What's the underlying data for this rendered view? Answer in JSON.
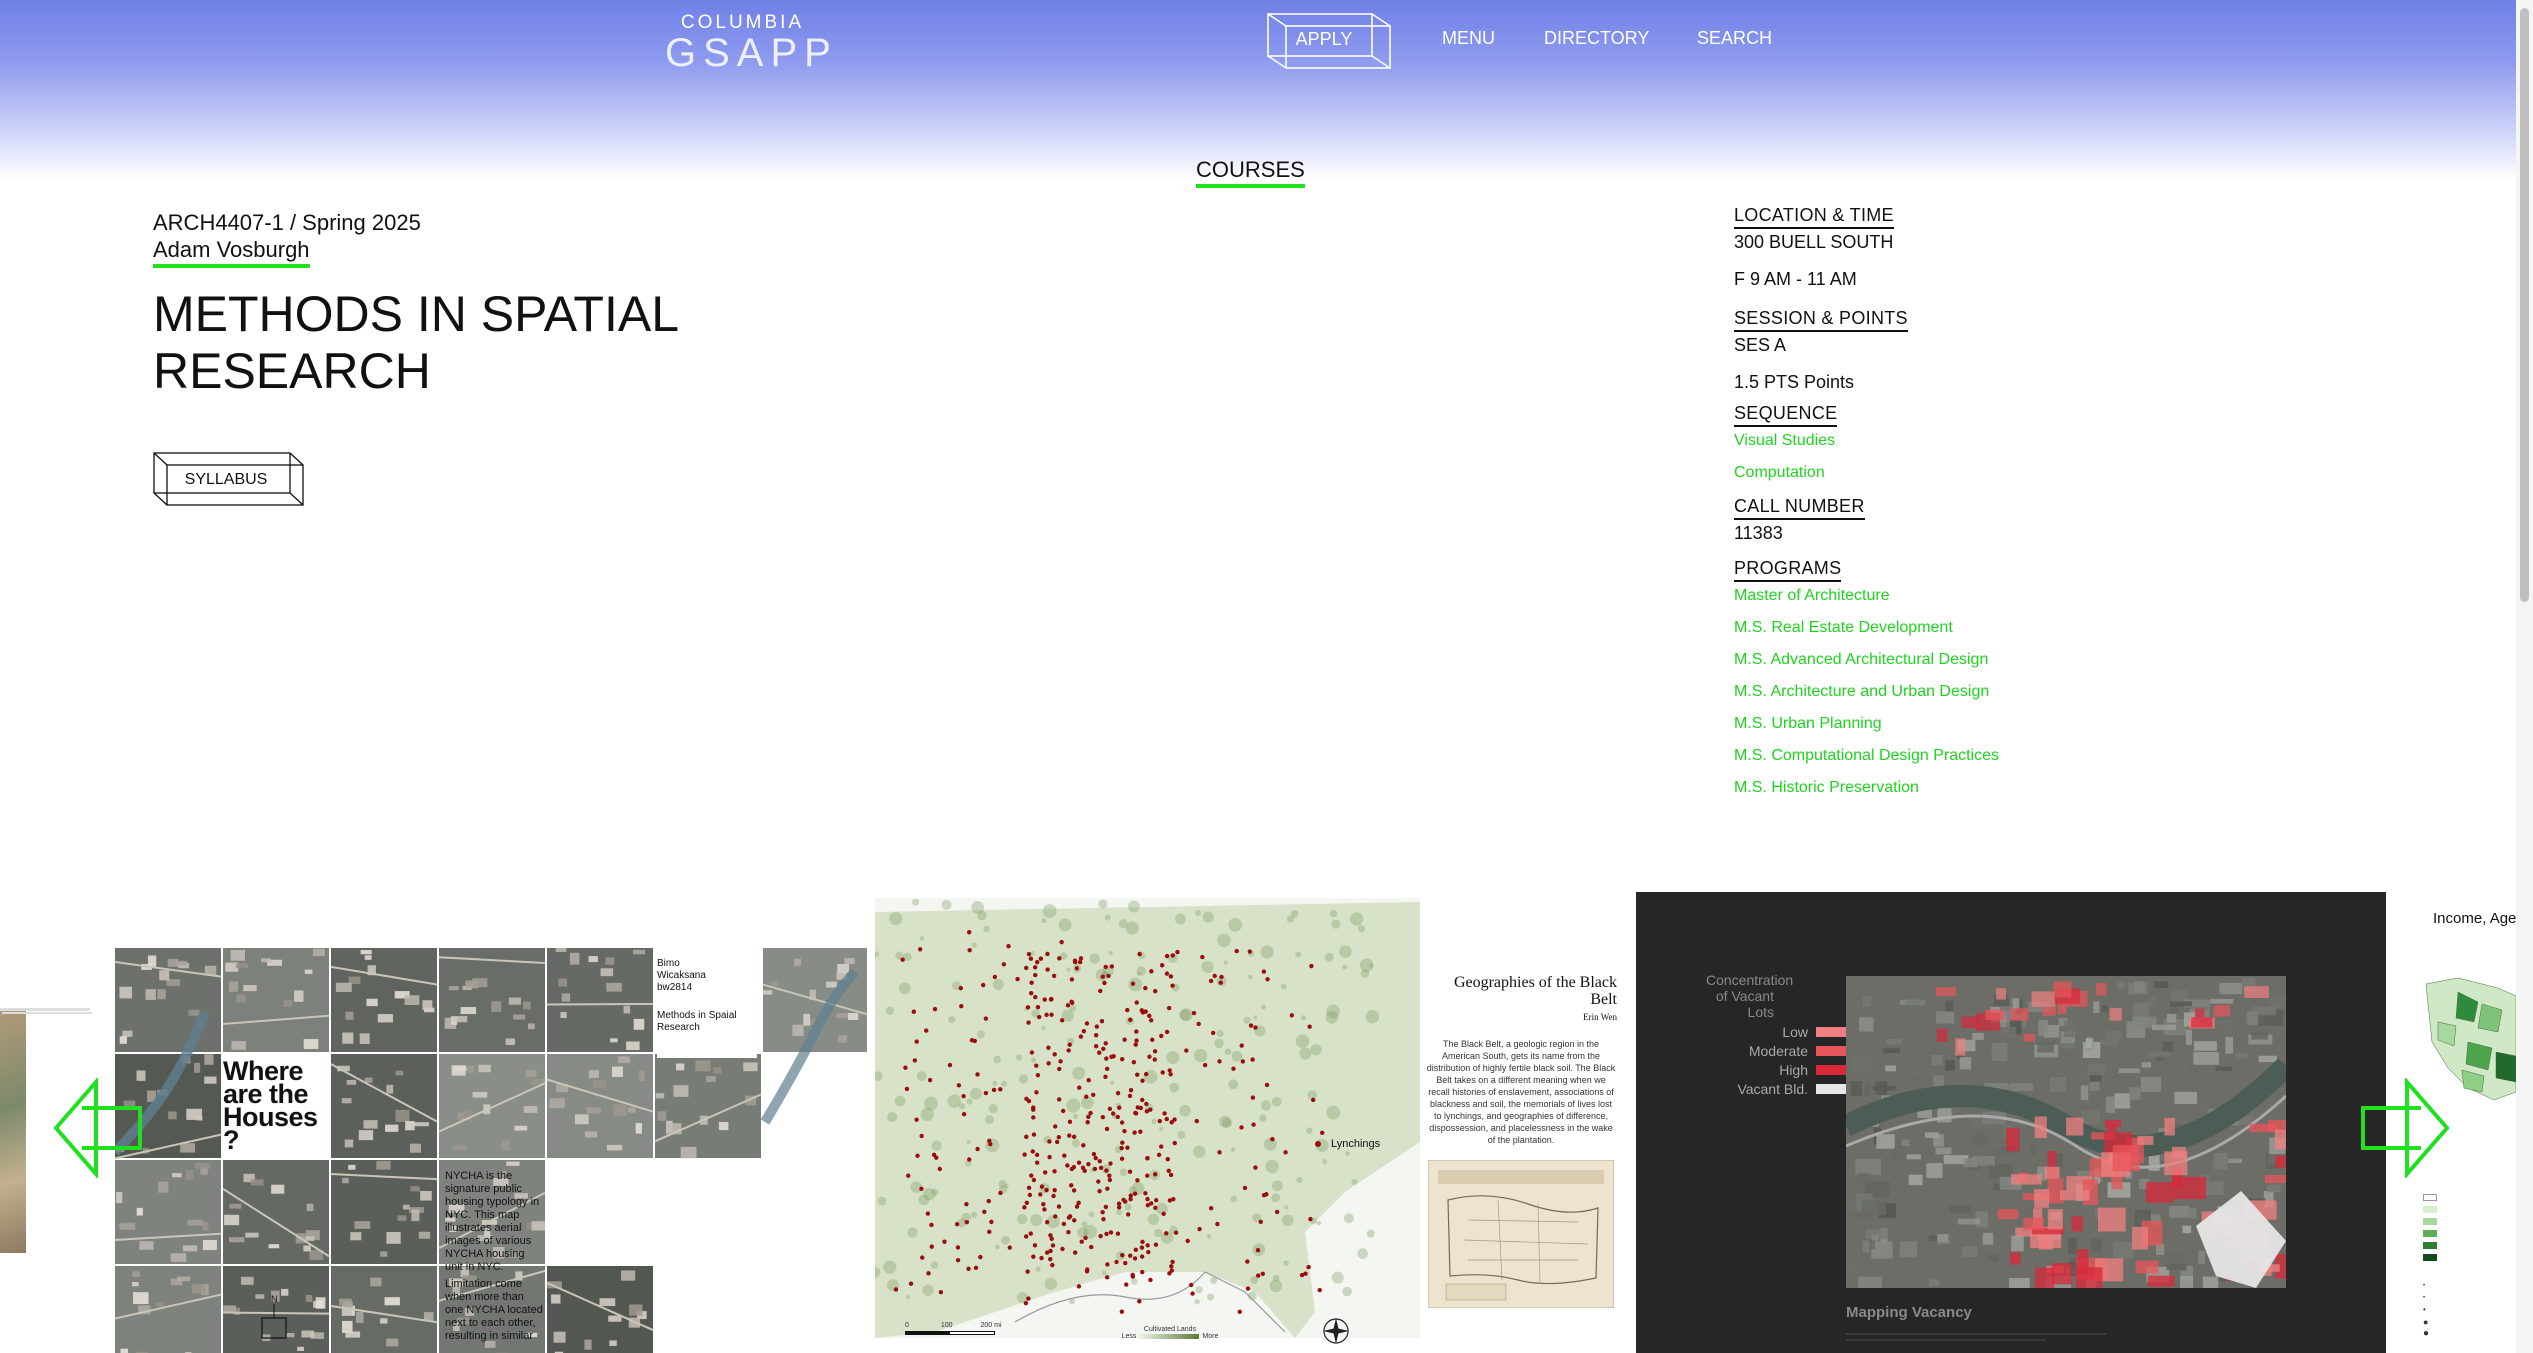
{
  "header": {
    "logo_top": "COLUMBIA",
    "logo_bottom": "GSAPP",
    "apply_label": "APPLY",
    "nav": [
      "MENU",
      "DIRECTORY",
      "SEARCH"
    ]
  },
  "breadcrumb": "COURSES",
  "course": {
    "code": "ARCH4407-1 / Spring 2025",
    "instructor": "Adam Vosburgh",
    "title": "METHODS IN SPATIAL RESEARCH",
    "syllabus_label": "SYLLABUS"
  },
  "sidebar": {
    "location_head": "LOCATION & TIME",
    "location": "300 BUELL SOUTH",
    "time": "F 9 AM - 11 AM",
    "session_head": "SESSION & POINTS",
    "session": "SES A",
    "points": "1.5 PTS Points",
    "sequence_head": "SEQUENCE",
    "sequence": [
      "Visual Studies",
      "Computation"
    ],
    "call_head": "CALL NUMBER",
    "call_number": "11383",
    "programs_head": "PROGRAMS",
    "programs": [
      "Master of Architecture",
      "M.S. Real Estate Development",
      "M.S. Advanced Architectural Design",
      "M.S. Architecture and Urban Design",
      "M.S. Urban Planning",
      "M.S. Computational Design Practices",
      "M.S. Historic Preservation"
    ]
  },
  "slides": {
    "houses": {
      "author": "Bimo Wicaksana bw2814",
      "course": "Methods in Spaial Research",
      "headline": "Where are the Houses ?",
      "body1": "NYCHA is the signature public housing typology in NYC. This map illustrates aerial images of various NYCHA housing unit in NYC.",
      "body2": "Limitation come when more than one NYCHA located next to each other, resulting in similar",
      "north": "N"
    },
    "blackbelt": {
      "title": "Geographies of the Black Belt",
      "author": "Erin Wen",
      "legend": "Lynchings",
      "body": "The Black Belt, a geologic region in the American South, gets its name from the distribution of highly fertile black soil. The Black Belt takes on a different meaning when we recall histories of enslavement, associations of blackness and soil, the memorials of lives lost to lynchings, and geographies of difference, dispossession, and placelessness in the wake of the plantation.",
      "scale": [
        "0",
        "100",
        "200 mi"
      ],
      "cultivated": "Cultivated Lands",
      "less": "Less",
      "more": "More"
    },
    "vacancy": {
      "legend_title": "Concentration of Vacant Lots",
      "legend": [
        {
          "label": "Low",
          "color": "#f08080"
        },
        {
          "label": "Moderate",
          "color": "#e8555a"
        },
        {
          "label": "High",
          "color": "#d8283a"
        },
        {
          "label": "Vacant Bld.",
          "color": "#e6e6e6"
        }
      ],
      "caption": "Mapping Vacancy"
    },
    "income": {
      "title": "Income, Age,"
    }
  },
  "colors": {
    "accent": "#20e020",
    "header_top": "#6f7fe6"
  }
}
